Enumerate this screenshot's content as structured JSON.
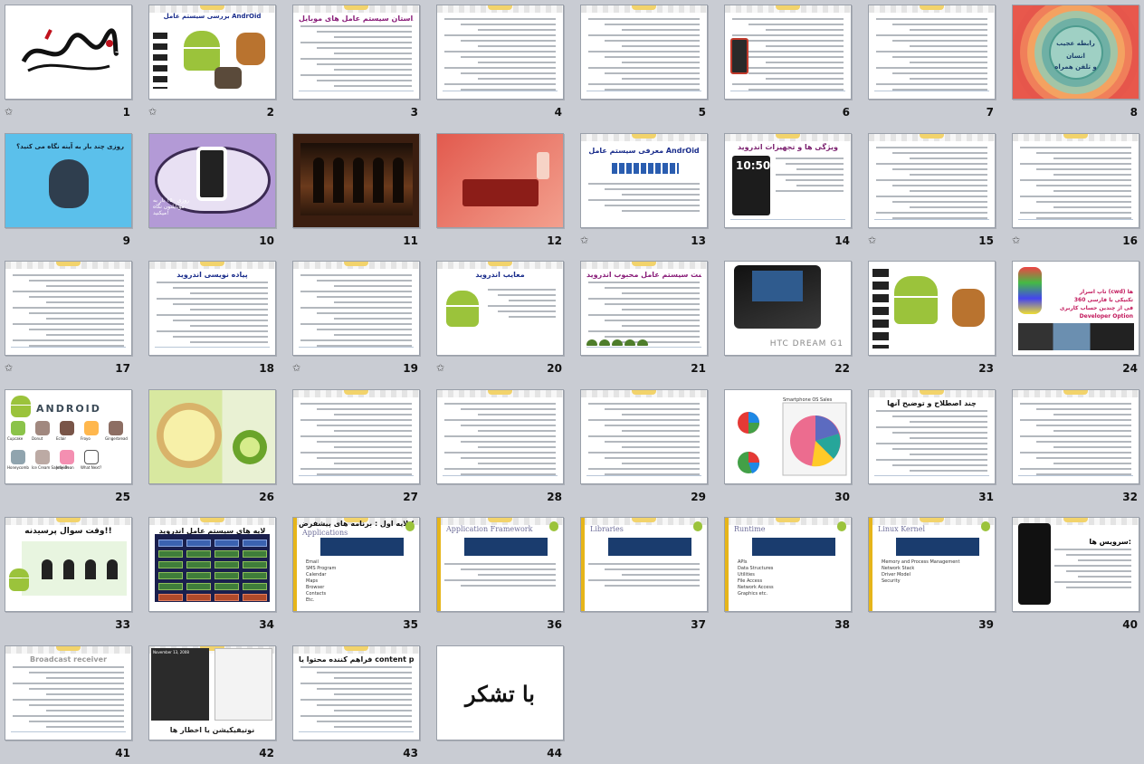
{
  "slides": [
    {
      "n": "1",
      "star": true,
      "kind": "calligraphy"
    },
    {
      "n": "2",
      "star": true,
      "kind": "android-title",
      "title": "بررسی سیستم عامل AndrOid"
    },
    {
      "n": "3",
      "star": false,
      "kind": "text",
      "title": "داستان سیستم عامل های موبایل",
      "titleColor": "#8a1f7a"
    },
    {
      "n": "4",
      "star": false,
      "kind": "text",
      "title": ""
    },
    {
      "n": "5",
      "star": false,
      "kind": "text",
      "title": ""
    },
    {
      "n": "6",
      "star": false,
      "kind": "text-phone",
      "title": ""
    },
    {
      "n": "7",
      "star": false,
      "kind": "text",
      "title": ""
    },
    {
      "n": "8",
      "star": false,
      "kind": "circles",
      "caption1": "رابطه عجیب",
      "caption2": "انسان",
      "caption3": "و تلفن همراه"
    },
    {
      "n": "9",
      "star": false,
      "kind": "face",
      "caption": "روزی چند بار به آینه نگاه می کنید؟"
    },
    {
      "n": "10",
      "star": false,
      "kind": "eye",
      "caption": "روزی ۱۵۰ بار به موبایلتون نگاه میکنید!"
    },
    {
      "n": "11",
      "star": false,
      "kind": "photo-dark"
    },
    {
      "n": "12",
      "star": false,
      "kind": "photo-red"
    },
    {
      "n": "13",
      "star": true,
      "kind": "android-logo",
      "title": "معرفی سیستم عامل AndrOid"
    },
    {
      "n": "14",
      "star": false,
      "kind": "features",
      "title": "ویژگی ها و تجهیزات اندروید",
      "time": "10:50"
    },
    {
      "n": "15",
      "star": true,
      "kind": "text",
      "title": ""
    },
    {
      "n": "16",
      "star": true,
      "kind": "text",
      "title": ""
    },
    {
      "n": "17",
      "star": true,
      "kind": "text",
      "title": ""
    },
    {
      "n": "18",
      "star": false,
      "kind": "text",
      "title": "پیاده نویسی اندروید",
      "titleColor": "#1b2e8c"
    },
    {
      "n": "19",
      "star": true,
      "kind": "text",
      "title": ""
    },
    {
      "n": "20",
      "star": true,
      "kind": "droid-center",
      "title": "معایب اندروید"
    },
    {
      "n": "21",
      "star": false,
      "kind": "text-turtles",
      "title": "سرگذشت سیستم عامل محبوب اندروید",
      "titleColor": "#8a1f7a"
    },
    {
      "n": "22",
      "star": false,
      "kind": "htc",
      "caption": "HTC DREAM G1"
    },
    {
      "n": "23",
      "star": false,
      "kind": "android-big"
    },
    {
      "n": "24",
      "star": false,
      "kind": "dev-options",
      "caption1": "تاپ اسرار (cwd) ها",
      "caption2": "تکنیکی با فارسی 360",
      "caption3": "فی از چندین حساب کاربری",
      "caption4": "Developer Option"
    },
    {
      "n": "25",
      "star": false,
      "kind": "versions",
      "labels": [
        "Cupcake",
        "Donut",
        "Eclair",
        "Froyo",
        "Gingerbread",
        "Honeycomb",
        "Ice Cream Sandwich",
        "Jelly Bean",
        "What Next?"
      ],
      "brand": "ANDROID"
    },
    {
      "n": "26",
      "star": false,
      "kind": "keylime"
    },
    {
      "n": "27",
      "star": false,
      "kind": "text",
      "title": ""
    },
    {
      "n": "28",
      "star": false,
      "kind": "text",
      "title": ""
    },
    {
      "n": "29",
      "star": false,
      "kind": "text",
      "title": ""
    },
    {
      "n": "30",
      "star": false,
      "kind": "pies",
      "title": "Smartphone OS Sales"
    },
    {
      "n": "31",
      "star": false,
      "kind": "text",
      "title": "چند اصطلاح و توضیح آنها",
      "titleColor": "#111"
    },
    {
      "n": "32",
      "star": false,
      "kind": "text",
      "title": ""
    },
    {
      "n": "33",
      "star": false,
      "kind": "question",
      "title": "وقت سوال پرسیدنه!!"
    },
    {
      "n": "34",
      "star": false,
      "kind": "arch",
      "title": "لایه های سیستم عامل اندروید"
    },
    {
      "n": "35",
      "star": false,
      "kind": "layer-list",
      "title": "لایه اول : برنامه های پیشفرض Gapps",
      "sub": "Applications",
      "items": [
        "Email",
        "SMS Program",
        "Calendar",
        "Maps",
        "Browser",
        "Contacts",
        "Etc."
      ]
    },
    {
      "n": "36",
      "star": false,
      "kind": "layer-fw",
      "sub": "Application Framework"
    },
    {
      "n": "37",
      "star": false,
      "kind": "layer-small",
      "sub": "Libraries"
    },
    {
      "n": "38",
      "star": false,
      "kind": "layer-list",
      "title": "",
      "sub": "Runtime",
      "items": [
        "APIs",
        "Data Structures",
        "Utilities",
        "File Access",
        "Network Access",
        "Graphics etc."
      ]
    },
    {
      "n": "39",
      "star": false,
      "kind": "layer-list",
      "title": "",
      "sub": "Linux Kernel",
      "items": [
        "Memory and Process Management",
        "Network Stack",
        "Driver Model",
        "Security"
      ]
    },
    {
      "n": "40",
      "star": false,
      "kind": "services",
      "title": "سرویس ها:"
    },
    {
      "n": "41",
      "star": false,
      "kind": "text",
      "title": "Broadcast receiver",
      "titleColor": "#999"
    },
    {
      "n": "42",
      "star": false,
      "kind": "notif",
      "title": "نوتیفیکیشن یا اخطار ها",
      "date": "November 13, 2008"
    },
    {
      "n": "43",
      "star": false,
      "kind": "text",
      "title": "فراهم کننده محتوا یا content provider",
      "titleColor": "#111"
    },
    {
      "n": "44",
      "star": false,
      "kind": "thanks",
      "title": "با تشکر"
    }
  ]
}
